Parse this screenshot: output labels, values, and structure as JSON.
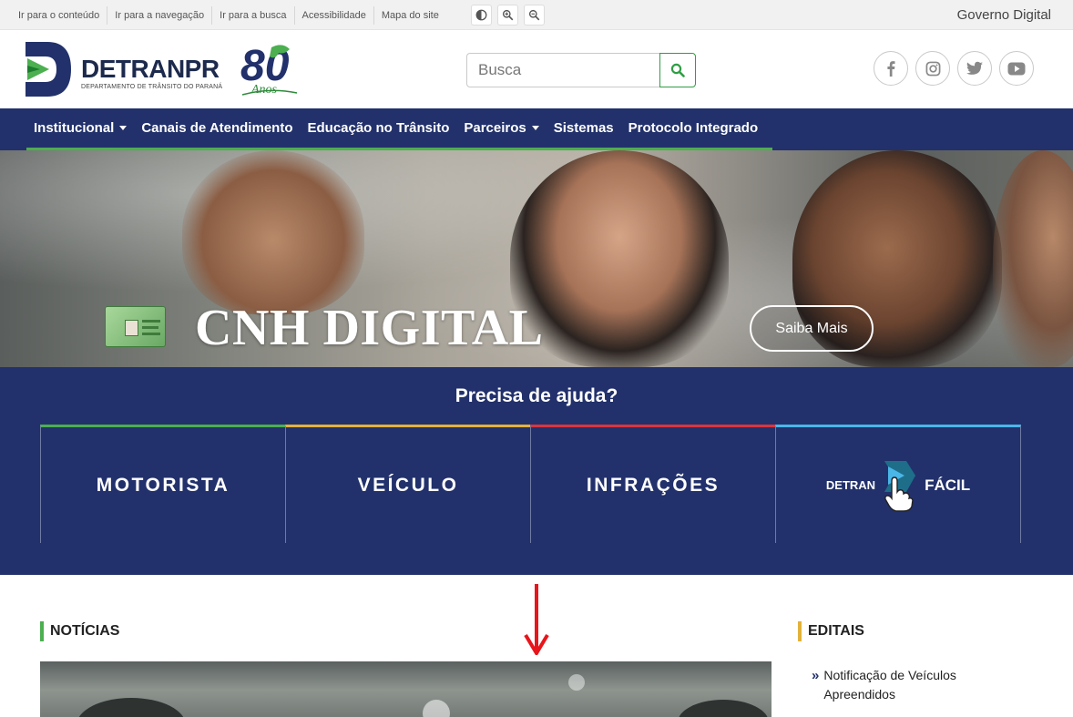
{
  "topbar": {
    "links": [
      "Ir para o conteúdo",
      "Ir para a navegação",
      "Ir para a busca",
      "Acessibilidade",
      "Mapa do site"
    ],
    "tools": [
      "contrast-icon",
      "zoom-in-icon",
      "zoom-out-icon"
    ],
    "gov_label": "Governo Digital"
  },
  "header": {
    "brand_main": "DETRAN",
    "brand_pr": "PR",
    "brand_sub": "DEPARTAMENTO DE TRÂNSITO DO PARANÁ",
    "anos_number": "80",
    "anos_label": "Anos",
    "search_placeholder": "Busca",
    "socials": [
      "facebook-icon",
      "instagram-icon",
      "twitter-icon",
      "youtube-icon"
    ]
  },
  "nav": {
    "items": [
      {
        "label": "Institucional",
        "dropdown": true
      },
      {
        "label": "Canais de Atendimento",
        "dropdown": false
      },
      {
        "label": "Educação no Trânsito",
        "dropdown": false
      },
      {
        "label": "Parceiros",
        "dropdown": true
      },
      {
        "label": "Sistemas",
        "dropdown": false
      },
      {
        "label": "Protocolo Integrado",
        "dropdown": false
      }
    ]
  },
  "hero": {
    "title": "CNH DIGITAL",
    "cta": "Saiba Mais"
  },
  "help": {
    "title": "Precisa de ajuda?",
    "cards": [
      "MOTORISTA",
      "VEÍCULO",
      "INFRAÇÕES"
    ],
    "facil_left": "DETRAN",
    "facil_right": "FÁCIL"
  },
  "content": {
    "news_title": "NOTÍCIAS",
    "editais_title": "EDITAIS",
    "editais_items": [
      "Notificação de Veículos Apreendidos"
    ]
  },
  "colors": {
    "navy": "#22316b",
    "green": "#4caf50",
    "yellow": "#e3b23c",
    "red": "#d9363e",
    "blue": "#4ab6e8"
  }
}
